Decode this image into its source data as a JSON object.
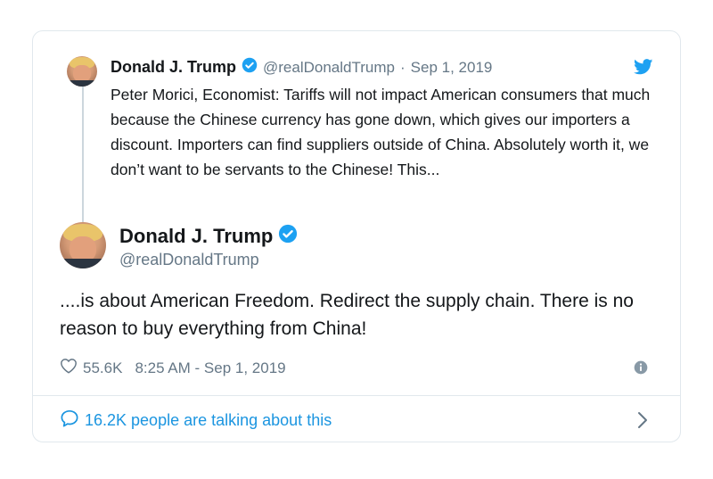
{
  "quoted_tweet": {
    "name": "Donald J. Trump",
    "handle": "@realDonaldTrump",
    "separator": "·",
    "date": "Sep 1, 2019",
    "text": "Peter Morici, Economist: Tariffs will not impact American consumers that much because the Chinese currency has gone down, which gives our importers a discount. Importers can find suppliers outside of China. Absolutely worth it, we don’t want to be servants to the Chinese! This..."
  },
  "main_tweet": {
    "name": "Donald J. Trump",
    "handle": "@realDonaldTrump",
    "text": "....is about American Freedom. Redirect the supply chain. There is no reason to buy everything from China!",
    "likes": "55.6K",
    "timestamp": "8:25 AM - Sep 1, 2019"
  },
  "footer": {
    "talking": "16.2K people are talking about this"
  },
  "icons": {
    "verified": "verified-badge-icon",
    "bird": "twitter-bird-icon",
    "heart": "heart-icon",
    "info": "info-icon",
    "bubble": "speech-bubble-icon",
    "chevron": "chevron-right-icon"
  },
  "colors": {
    "accent": "#1da1f2",
    "link": "#1b95e0",
    "muted": "#657786",
    "text": "#14171a",
    "border": "#e1e8ed"
  }
}
